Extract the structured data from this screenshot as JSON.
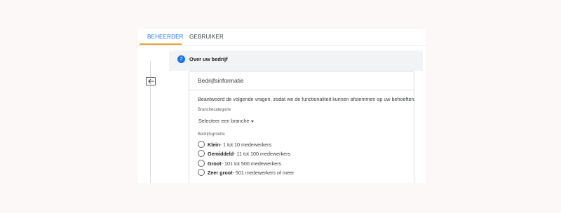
{
  "tabs": [
    {
      "label": "BEHEERDER",
      "active": true
    },
    {
      "label": "GEBRUIKER",
      "active": false
    }
  ],
  "step": {
    "number": "2",
    "title": "Over uw bedrijf"
  },
  "card": {
    "title": "Bedrijfsinformatie",
    "intro": "Beantwoord de volgende vragen, zodat we de functionaliteit kunnen afstemmen op uw behoeften.",
    "industry": {
      "label": "Branchecategorie",
      "selected": "Selecteer een branche"
    },
    "size": {
      "label": "Bedrijfsgrootte",
      "options": [
        {
          "name": "Klein",
          "detail": " - 1 tot 10 medewerkers"
        },
        {
          "name": "Gemiddeld",
          "detail": " - 11 tot 100 medewerkers"
        },
        {
          "name": "Groot",
          "detail": " - 101 tot 500 medewerkers"
        },
        {
          "name": "Zeer groot",
          "detail": " - 501 medewerkers of meer"
        }
      ]
    }
  },
  "colors": {
    "accent": "#1a73e8",
    "tab_underline": "#e8a33a",
    "background": "#fcf8f7"
  }
}
